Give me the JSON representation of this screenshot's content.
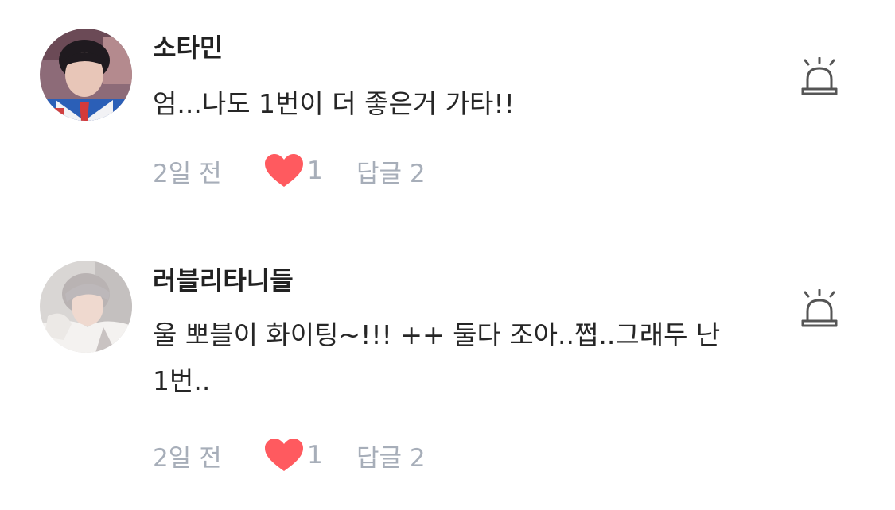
{
  "comments": [
    {
      "username": "소타민",
      "text": "엄...나도 1번이 더 좋은거 가타!!",
      "time": "2일 전",
      "likes": "1",
      "reply": "답글 2"
    },
    {
      "username": "러블리타니들",
      "text": "울 뽀블이 화이팅~!!! ++ 둘다 조아..쩝..그래두 난 1번..",
      "time": "2일 전",
      "likes": "1",
      "reply": "답글 2"
    }
  ],
  "colors": {
    "heart": "#ff5a5f",
    "meta_text": "#a7aeb9",
    "username": "#222222",
    "report_icon": "#555555"
  },
  "icons": {
    "report": "siren-icon",
    "like": "heart-icon"
  }
}
